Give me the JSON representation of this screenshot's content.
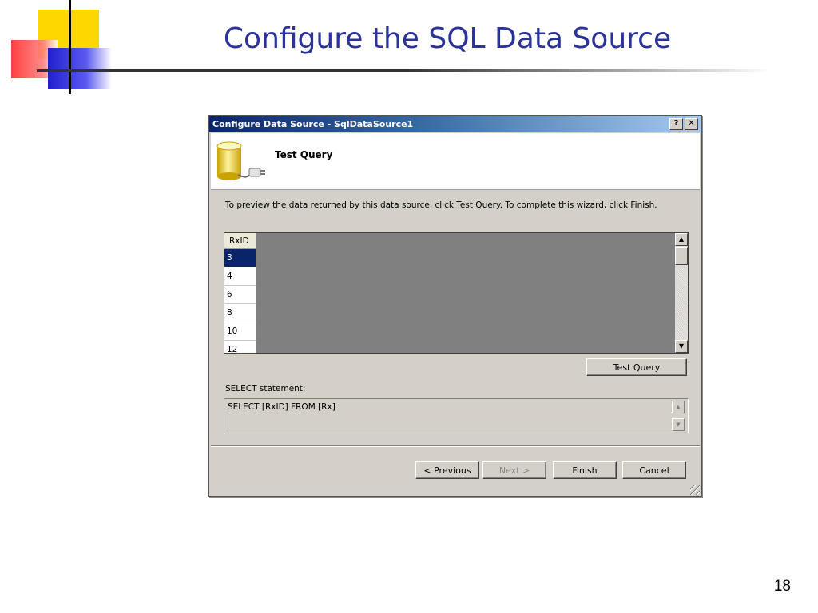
{
  "slide": {
    "title": "Configure the SQL Data Source",
    "page_number": "18"
  },
  "dialog": {
    "title": "Configure Data Source - SqlDataSource1",
    "help_button": "?",
    "close_button": "✕",
    "header_title": "Test Query",
    "instruction": "To preview the data returned by this data source, click Test Query. To complete this wizard, click Finish.",
    "grid": {
      "column": "RxID",
      "rows": [
        "3",
        "4",
        "6",
        "8",
        "10",
        "12"
      ],
      "selected_index": 0
    },
    "test_query_label": "Test Query",
    "select_label": "SELECT statement:",
    "select_value": "SELECT [RxID] FROM [Rx]",
    "buttons": {
      "previous": "< Previous",
      "next": "Next >",
      "finish": "Finish",
      "cancel": "Cancel"
    }
  }
}
